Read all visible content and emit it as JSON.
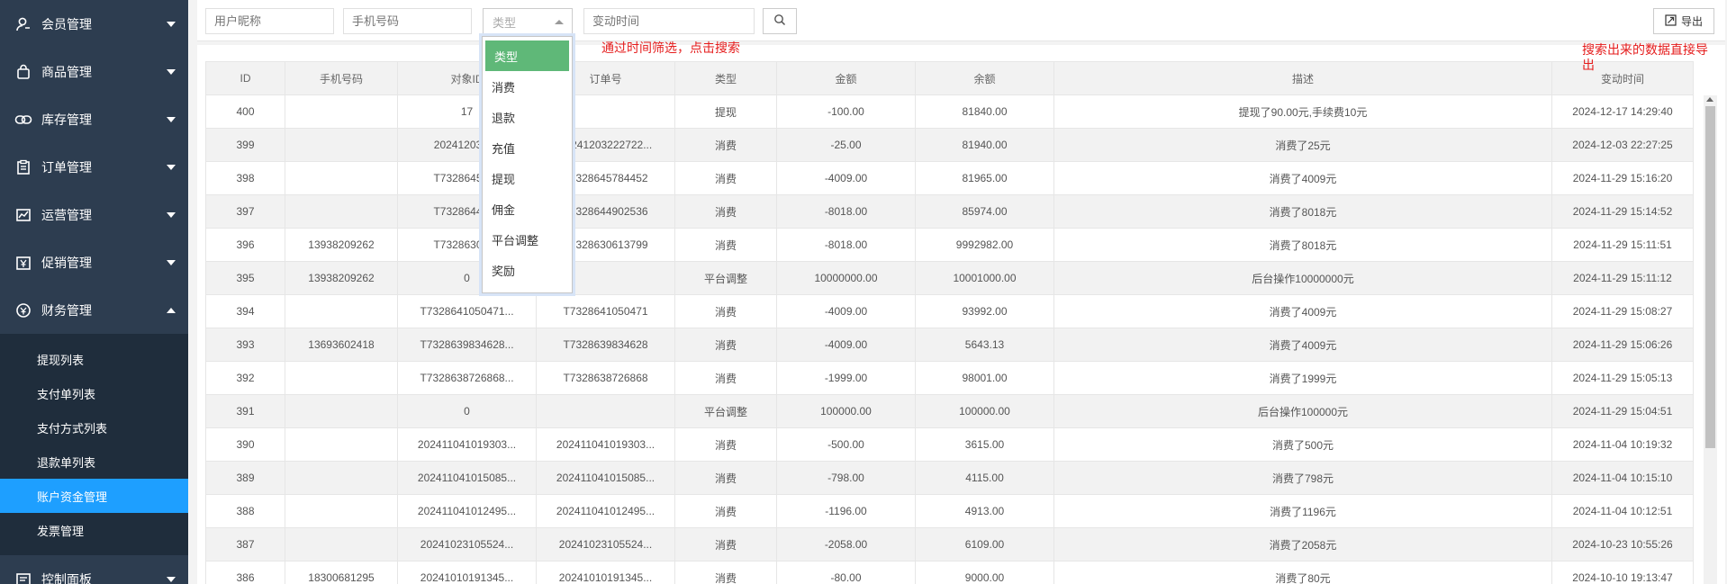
{
  "sidebar": {
    "items": [
      {
        "label": "会员管理",
        "icon": "user-icon",
        "open": false
      },
      {
        "label": "商品管理",
        "icon": "bag-icon",
        "open": false
      },
      {
        "label": "库存管理",
        "icon": "link-icon",
        "open": false
      },
      {
        "label": "订单管理",
        "icon": "clipboard-icon",
        "open": false
      },
      {
        "label": "运营管理",
        "icon": "chart-icon",
        "open": false
      },
      {
        "label": "促销管理",
        "icon": "promo-icon",
        "open": false
      },
      {
        "label": "财务管理",
        "icon": "finance-icon",
        "open": true
      }
    ],
    "sub_items": [
      {
        "label": "提现列表",
        "active": false
      },
      {
        "label": "支付单列表",
        "active": false
      },
      {
        "label": "支付方式列表",
        "active": false
      },
      {
        "label": "退款单列表",
        "active": false
      },
      {
        "label": "账户资金管理",
        "active": true
      },
      {
        "label": "发票管理",
        "active": false
      }
    ],
    "bottom_item": {
      "label": "控制面板",
      "icon": "dashboard-icon"
    },
    "colors": {
      "bg": "#2d3d50",
      "submenu_bg": "#1f2d3c",
      "active": "#1e9fff"
    }
  },
  "filters": {
    "nickname_placeholder": "用户昵称",
    "phone_placeholder": "手机号码",
    "type_placeholder": "类型",
    "time_placeholder": "变动时间",
    "export_label": "导出"
  },
  "type_dropdown": {
    "options": [
      "类型",
      "消费",
      "退款",
      "充值",
      "提现",
      "佣金",
      "平台调整",
      "奖励"
    ],
    "selected": "类型",
    "selected_color": "#5fb878"
  },
  "annotations": {
    "search_note": "通过时间筛选，点击搜索",
    "export_note": "搜索出来的数据直接导出"
  },
  "table": {
    "columns": [
      "ID",
      "手机号码",
      "对象ID",
      "订单号",
      "类型",
      "金额",
      "余额",
      "描述",
      "变动时间"
    ],
    "rows": [
      [
        "400",
        "",
        "17",
        "",
        "提现",
        "-100.00",
        "81840.00",
        "提现了90.00元,手续费10元",
        "2024-12-17 14:29:40"
      ],
      [
        "399",
        "",
        "20241203222",
        "20241203222722...",
        "消费",
        "-25.00",
        "81940.00",
        "消费了25元",
        "2024-12-03 22:27:25"
      ],
      [
        "398",
        "",
        "T7328645784",
        "T7328645784452",
        "消费",
        "-4009.00",
        "81965.00",
        "消费了4009元",
        "2024-11-29 15:16:20"
      ],
      [
        "397",
        "",
        "T7328644902",
        "T7328644902536",
        "消费",
        "-8018.00",
        "85974.00",
        "消费了8018元",
        "2024-11-29 15:14:52"
      ],
      [
        "396",
        "13938209262",
        "T7328630613",
        "T7328630613799",
        "消费",
        "-8018.00",
        "9992982.00",
        "消费了8018元",
        "2024-11-29 15:11:51"
      ],
      [
        "395",
        "13938209262",
        "0",
        "",
        "平台调整",
        "10000000.00",
        "10001000.00",
        "后台操作10000000元",
        "2024-11-29 15:11:12"
      ],
      [
        "394",
        "",
        "T7328641050471...",
        "T7328641050471",
        "消费",
        "-4009.00",
        "93992.00",
        "消费了4009元",
        "2024-11-29 15:08:27"
      ],
      [
        "393",
        "13693602418",
        "T7328639834628...",
        "T7328639834628",
        "消费",
        "-4009.00",
        "5643.13",
        "消费了4009元",
        "2024-11-29 15:06:26"
      ],
      [
        "392",
        "",
        "T7328638726868...",
        "T7328638726868",
        "消费",
        "-1999.00",
        "98001.00",
        "消费了1999元",
        "2024-11-29 15:05:13"
      ],
      [
        "391",
        "",
        "0",
        "",
        "平台调整",
        "100000.00",
        "100000.00",
        "后台操作100000元",
        "2024-11-29 15:04:51"
      ],
      [
        "390",
        "",
        "202411041019303...",
        "202411041019303...",
        "消费",
        "-500.00",
        "3615.00",
        "消费了500元",
        "2024-11-04 10:19:32"
      ],
      [
        "389",
        "",
        "202411041015085...",
        "202411041015085...",
        "消费",
        "-798.00",
        "4115.00",
        "消费了798元",
        "2024-11-04 10:15:10"
      ],
      [
        "388",
        "",
        "202411041012495...",
        "202411041012495...",
        "消费",
        "-1196.00",
        "4913.00",
        "消费了1196元",
        "2024-11-04 10:12:51"
      ],
      [
        "387",
        "",
        "20241023105524...",
        "20241023105524...",
        "消费",
        "-2058.00",
        "6109.00",
        "消费了2058元",
        "2024-10-23 10:55:26"
      ],
      [
        "386",
        "18300681295",
        "20241010191345...",
        "20241010191345...",
        "消费",
        "-80.00",
        "9000.00",
        "消费了80元",
        "2024-10-10 19:13:47"
      ]
    ]
  }
}
